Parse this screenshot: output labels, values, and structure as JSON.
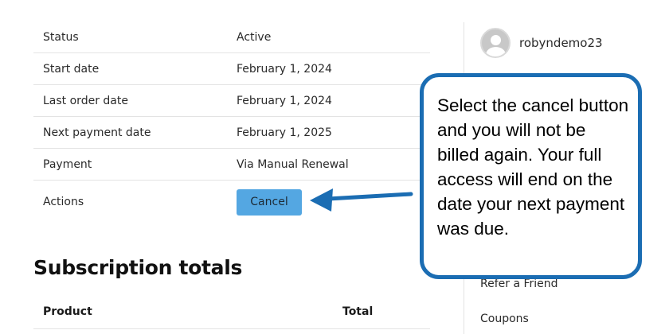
{
  "details": {
    "rows": [
      {
        "label": "Status",
        "value": "Active"
      },
      {
        "label": "Start date",
        "value": "February 1, 2024"
      },
      {
        "label": "Last order date",
        "value": "February 1, 2024"
      },
      {
        "label": "Next payment date",
        "value": "February 1, 2025"
      },
      {
        "label": "Payment",
        "value": "Via Manual Renewal"
      }
    ],
    "actions_label": "Actions",
    "cancel_label": "Cancel"
  },
  "totals": {
    "heading": "Subscription totals",
    "columns": [
      "Product",
      "Total"
    ]
  },
  "sidebar": {
    "username": "robyndemo23",
    "links": [
      "Refer a Friend",
      "Coupons"
    ]
  },
  "callout": {
    "text": "Select the cancel button and you will not be billed again. Your full access will end on the date your next payment was due."
  },
  "colors": {
    "cancel_button": "#54a7e2",
    "callout_border": "#1b6db3",
    "arrow": "#1b6db3"
  },
  "icons": {
    "avatar": "default-user-avatar",
    "pointer": "left-arrow"
  }
}
